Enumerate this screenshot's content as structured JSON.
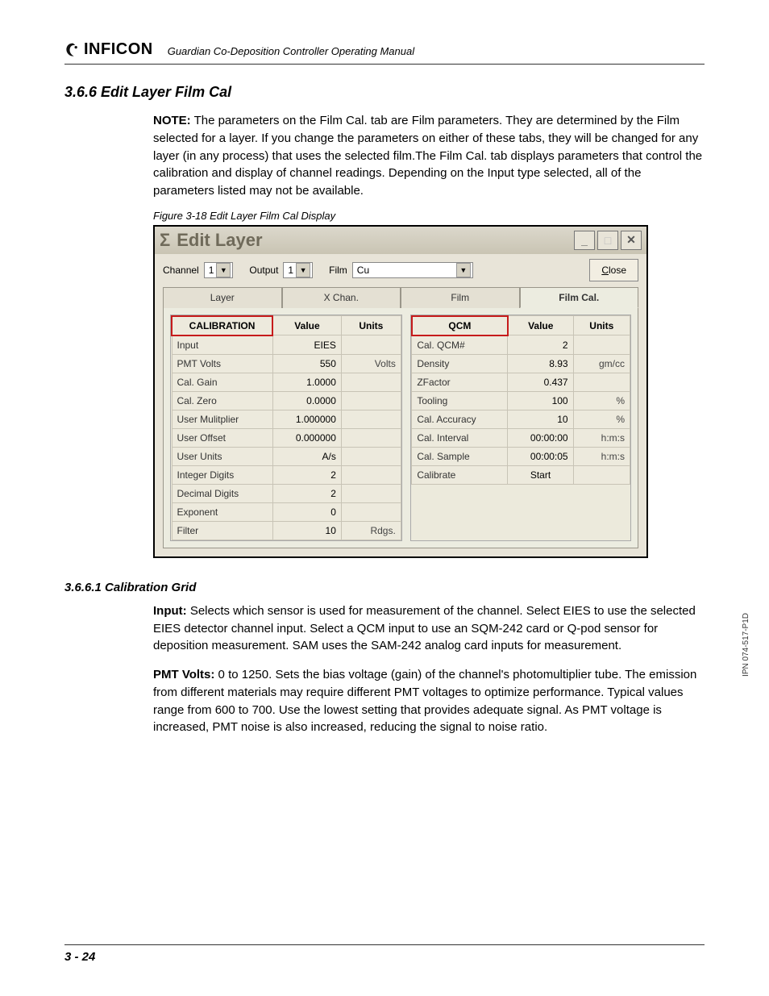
{
  "header": {
    "brand": "INFICON",
    "manual_title": "Guardian Co-Deposition Controller Operating Manual"
  },
  "section": {
    "number_title": "3.6.6  Edit Layer Film Cal",
    "note_label": "NOTE:",
    "note_text": "The parameters on the Film Cal. tab are Film parameters. They are determined by the Film selected for a layer. If you change the parameters on either of these tabs, they will be changed for any layer (in any process) that uses the selected film.The Film Cal. tab displays parameters that control the calibration and display of channel readings. Depending on the Input type selected, all of the parameters listed may not be available.",
    "figure_caption": "Figure 3-18  Edit Layer Film Cal Display"
  },
  "window": {
    "title_sigma": "Σ",
    "title": "Edit Layer",
    "btn_min": "_",
    "btn_max": "□",
    "btn_close_x": "✕",
    "row": {
      "channel_label": "Channel",
      "channel_value": "1",
      "output_label": "Output",
      "output_value": "1",
      "film_label": "Film",
      "film_value": "Cu",
      "close_u": "C",
      "close_rest": "lose"
    },
    "tabs": {
      "layer": "Layer",
      "xchan": "X Chan.",
      "film": "Film",
      "filmcal": "Film Cal."
    },
    "grid1": {
      "h1": "CALIBRATION",
      "h2": "Value",
      "h3": "Units",
      "rows": [
        {
          "label": "Input",
          "value": "EIES",
          "units": ""
        },
        {
          "label": "PMT Volts",
          "value": "550",
          "units": "Volts"
        },
        {
          "label": "Cal. Gain",
          "value": "1.0000",
          "units": ""
        },
        {
          "label": "Cal. Zero",
          "value": "0.0000",
          "units": ""
        },
        {
          "label": "User Mulitplier",
          "value": "1.000000",
          "units": ""
        },
        {
          "label": "User Offset",
          "value": "0.000000",
          "units": ""
        },
        {
          "label": "User Units",
          "value": "A/s",
          "units": ""
        },
        {
          "label": "Integer Digits",
          "value": "2",
          "units": ""
        },
        {
          "label": "Decimal Digits",
          "value": "2",
          "units": ""
        },
        {
          "label": "Exponent",
          "value": "0",
          "units": ""
        },
        {
          "label": "Filter",
          "value": "10",
          "units": "Rdgs."
        }
      ]
    },
    "grid2": {
      "h1": "QCM",
      "h2": "Value",
      "h3": "Units",
      "rows": [
        {
          "label": "Cal. QCM#",
          "value": "2",
          "units": ""
        },
        {
          "label": "Density",
          "value": "8.93",
          "units": "gm/cc"
        },
        {
          "label": "ZFactor",
          "value": "0.437",
          "units": ""
        },
        {
          "label": "Tooling",
          "value": "100",
          "units": "%"
        },
        {
          "label": "Cal. Accuracy",
          "value": "10",
          "units": "%"
        },
        {
          "label": "Cal. Interval",
          "value": "00:00:00",
          "units": "h:m:s"
        },
        {
          "label": "Cal. Sample",
          "value": "00:00:05",
          "units": "h:m:s"
        },
        {
          "label": "Calibrate",
          "value": "Start",
          "units": ""
        }
      ]
    }
  },
  "sub": {
    "heading": "3.6.6.1  Calibration Grid",
    "p1_lead": "Input:",
    "p1": " Selects which sensor is used for measurement of the channel. Select EIES to use the selected EIES detector channel input. Select a QCM input to use an SQM-242 card or Q-pod sensor for deposition measurement. SAM uses the SAM-242 analog card inputs for measurement.",
    "p2_lead": "PMT Volts:",
    "p2": " 0 to 1250. Sets the bias voltage (gain) of the channel's photomultiplier tube. The emission from different materials may require different PMT voltages to optimize performance. Typical values range from 600 to 700. Use the lowest setting that provides adequate signal. As PMT voltage is increased, PMT noise is also increased, reducing the signal to noise ratio."
  },
  "side_ipn": "IPN 074-517-P1D",
  "footer_page": "3 - 24"
}
